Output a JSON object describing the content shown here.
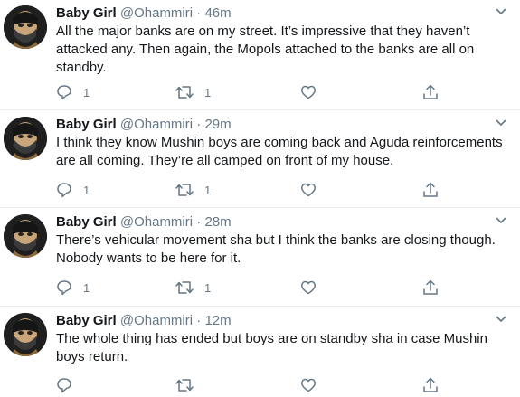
{
  "tweets": [
    {
      "name": "Baby Girl",
      "handle": "@Ohammiri",
      "separator": "·",
      "time": "46m",
      "text": "All the major banks are on my street. It’s impressive that they haven’t attacked any. Then again, the Mopols attached to the banks are all on standby.",
      "replies": "1",
      "retweets": "1",
      "likes": ""
    },
    {
      "name": "Baby Girl",
      "handle": "@Ohammiri",
      "separator": "·",
      "time": "29m",
      "text": "I think they know Mushin boys are coming back and Aguda reinforcements are all coming. They’re all camped on front of my house.",
      "replies": "1",
      "retweets": "1",
      "likes": ""
    },
    {
      "name": "Baby Girl",
      "handle": "@Ohammiri",
      "separator": "·",
      "time": "28m",
      "text": "There’s vehicular movement sha but I think the banks are closing though. Nobody wants to be here for it.",
      "replies": "1",
      "retweets": "1",
      "likes": ""
    },
    {
      "name": "Baby Girl",
      "handle": "@Ohammiri",
      "separator": "·",
      "time": "12m",
      "text": "The whole thing has ended but boys are on standby sha in case Mushin boys return.",
      "replies": "",
      "retweets": "",
      "likes": ""
    }
  ],
  "icons": {
    "avatar": "avatar-photo",
    "menu": "chevron-down-icon",
    "reply": "reply-icon",
    "retweet": "retweet-icon",
    "like": "heart-icon",
    "share": "share-icon"
  },
  "colors": {
    "text": "#14171a",
    "muted": "#657786",
    "divider": "#e6ecf0"
  }
}
